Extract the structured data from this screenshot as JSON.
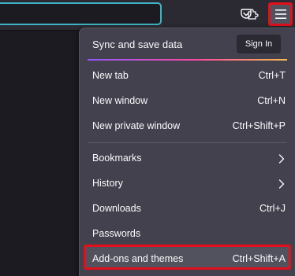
{
  "toolbar": {
    "pocket_icon": "pocket-icon",
    "extensions_icon": "extensions-puzzle-icon",
    "menu_icon": "hamburger-menu-icon",
    "highlight_color": "#e2101b",
    "urlbar_border_color": "#3fb4c4"
  },
  "menu": {
    "sync_label": "Sync and save data",
    "signin_label": "Sign In",
    "items": [
      {
        "label": "New tab",
        "shortcut": "Ctrl+T"
      },
      {
        "label": "New window",
        "shortcut": "Ctrl+N"
      },
      {
        "label": "New private window",
        "shortcut": "Ctrl+Shift+P"
      },
      {
        "label": "Bookmarks",
        "shortcut": ""
      },
      {
        "label": "History",
        "shortcut": ""
      },
      {
        "label": "Downloads",
        "shortcut": "Ctrl+J"
      },
      {
        "label": "Passwords",
        "shortcut": ""
      },
      {
        "label": "Add-ons and themes",
        "shortcut": "Ctrl+Shift+A"
      }
    ]
  }
}
